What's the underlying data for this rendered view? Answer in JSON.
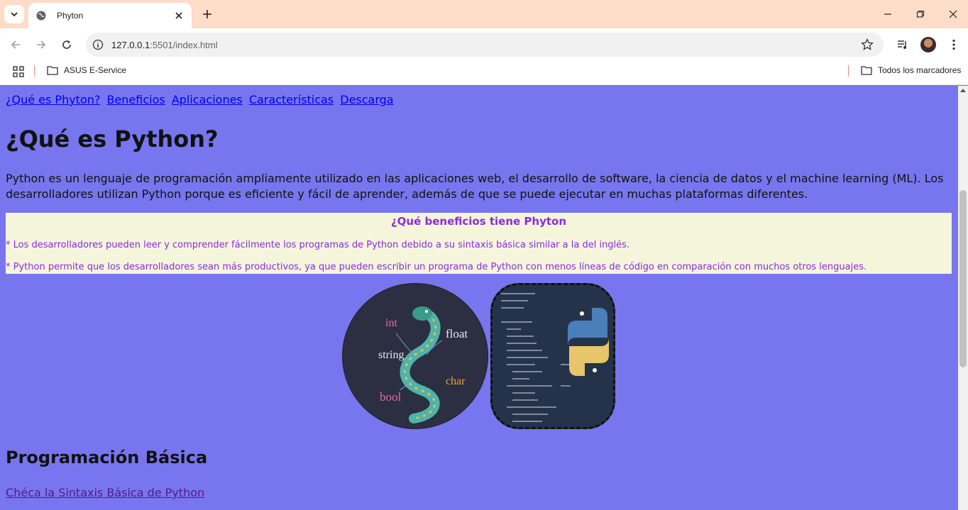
{
  "browser": {
    "tab_title": "Phyton",
    "url_host": "127.0.0.1",
    "url_rest": ":5501/index.html",
    "bookmarks": [
      "ASUS E-Service",
      "Todos los marcadores"
    ]
  },
  "page": {
    "nav_links": [
      "¿Qué es Phyton?",
      "Beneficios",
      "Aplicaciones",
      "Características",
      "Descarga"
    ],
    "title": "¿Qué es Python?",
    "intro": "Python es un lenguaje de programación ampliamente utilizado en las aplicaciones web, el desarrollo de software, la ciencia de datos y el machine learning (ML). Los desarrolladores utilizan Python porque es eficiente y fácil de aprender, además de que se puede ejecutar en muchas plataformas diferentes.",
    "benefits": {
      "title": "¿Qué beneficios tiene Phyton",
      "items": [
        "* Los desarrolladores pueden leer y comprender fácilmente los programas de Python debido a su sintaxis básica similar a la del inglés.",
        "* Python permite que los desarrolladores sean más productivos, ya que pueden escribir un programa de Python con menos líneas de código en comparación con muchos otros lenguajes."
      ]
    },
    "image1_words": {
      "int": "int",
      "float": "float",
      "string": "string",
      "char": "char",
      "bool": "bool"
    },
    "section2_title": "Programación Básica",
    "syntax_link": "Chéca la Sintaxis Básica de Python"
  },
  "colors": {
    "page_bg": "#7776ee",
    "benefits_bg": "#f5f5dc",
    "benefits_text": "#8a2be2",
    "link": "#0000ee",
    "visited_link": "#551a8b",
    "tabbar_bg": "#fddcc8"
  }
}
